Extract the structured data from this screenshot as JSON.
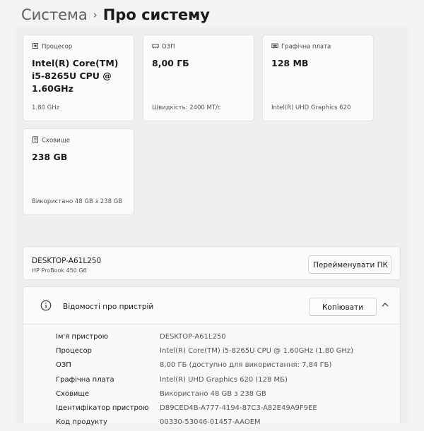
{
  "breadcrumb": {
    "parent": "Система",
    "separator": "›",
    "current": "Про систему"
  },
  "cards": {
    "processor": {
      "caption": "Процесор",
      "value": "Intel(R) Core(TM) i5-8265U CPU @ 1.60GHz",
      "sub": "1.80 GHz",
      "icon": "processor-icon"
    },
    "ram": {
      "caption": "ОЗП",
      "value": "8,00 ГБ",
      "sub": "Швидкість: 2400 MT/c",
      "icon": "ram-icon"
    },
    "gpu": {
      "caption": "Графічна плата",
      "value": "128 MB",
      "sub": "Intel(R) UHD Graphics 620",
      "icon": "gpu-icon"
    },
    "storage": {
      "caption": "Сховище",
      "value": "238 GB",
      "sub": "Використано 48 GB з 238 GB",
      "icon": "storage-icon"
    }
  },
  "device": {
    "name": "DESKTOP-A61L250",
    "model": "HP ProBook 450 G6",
    "rename_label": "Перейменувати ПК"
  },
  "specs_header": {
    "title": "Відомості про пристрій",
    "copy_label": "Копіювати"
  },
  "specs": [
    {
      "key": "Ім'я пристрою",
      "value": "DESKTOP-A61L250"
    },
    {
      "key": "Процесор",
      "value": "Intel(R) Core(TM) i5-8265U CPU @ 1.60GHz (1.80 GHz)"
    },
    {
      "key": "ОЗП",
      "value": "8,00 ГБ (доступно для використання: 7,84 ГБ)"
    },
    {
      "key": "Графічна плата",
      "value": "Intel(R) UHD Graphics 620 (128 МБ)"
    },
    {
      "key": "Сховище",
      "value": "Використано 48 GB з 238 GB"
    },
    {
      "key": "Ідентифікатор пристрою",
      "value": "D89CED4B-A777-4194-87C3-A82E49A9F9EE"
    },
    {
      "key": "Код продукту",
      "value": "00330-53046-01457-AAOEM"
    }
  ]
}
